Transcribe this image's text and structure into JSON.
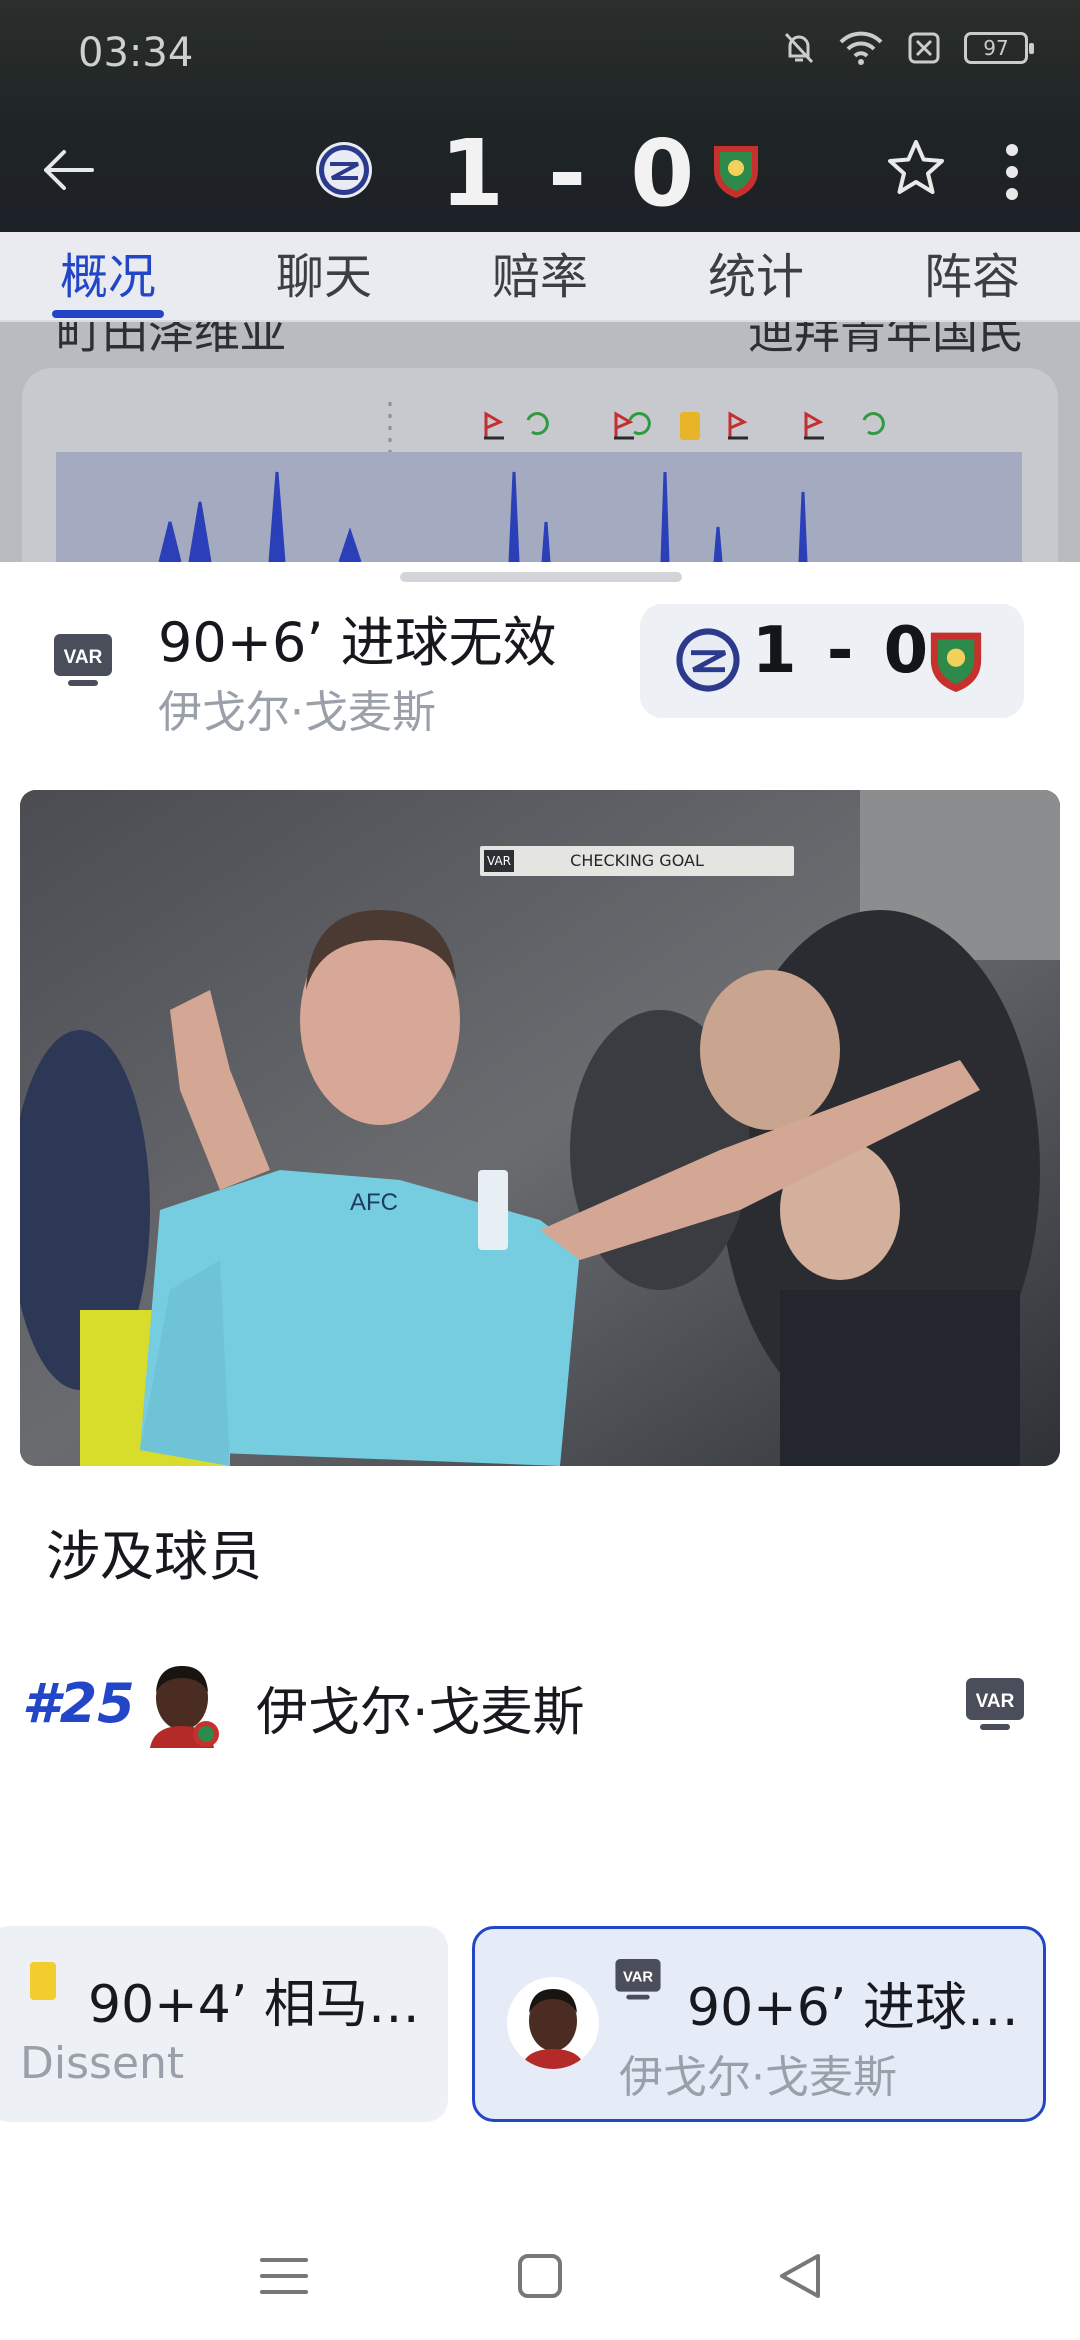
{
  "status_bar": {
    "time": "03:34",
    "battery": "97"
  },
  "header": {
    "home_score": "1",
    "separator": "-",
    "away_score": "0"
  },
  "tabs": [
    {
      "label": "概况",
      "active": true
    },
    {
      "label": "聊天",
      "active": false
    },
    {
      "label": "赔率",
      "active": false
    },
    {
      "label": "统计",
      "active": false
    },
    {
      "label": "阵容",
      "active": false
    }
  ],
  "background_page": {
    "home_name": "町田泽维亚",
    "away_name": "迪拜青年国民"
  },
  "sheet": {
    "event": {
      "badge": "VAR",
      "title": "90+6’ 进球无效",
      "player": "伊戈尔·戈麦斯",
      "home_score": "1",
      "separator": "-",
      "away_score": "0"
    },
    "video": {
      "overlay_badge": "VAR",
      "overlay_text": "CHECKING GOAL"
    },
    "section_title": "涉及球员",
    "involved_player": {
      "number": "#25",
      "name": "伊戈尔·戈麦斯",
      "badge": "VAR"
    },
    "event_cards": [
      {
        "icon": "yellow-card-icon",
        "title": "90+4’ 相马…",
        "subtitle": "Dissent",
        "selected": false
      },
      {
        "icon": "var-icon",
        "badge": "VAR",
        "title": "90+6’ 进球…",
        "subtitle": "伊戈尔·戈麦斯",
        "selected": true
      }
    ]
  },
  "colors": {
    "accent": "#2346c8",
    "yellow_card": "#f3cd2d",
    "home_goal_area": "#2a3fb8"
  }
}
